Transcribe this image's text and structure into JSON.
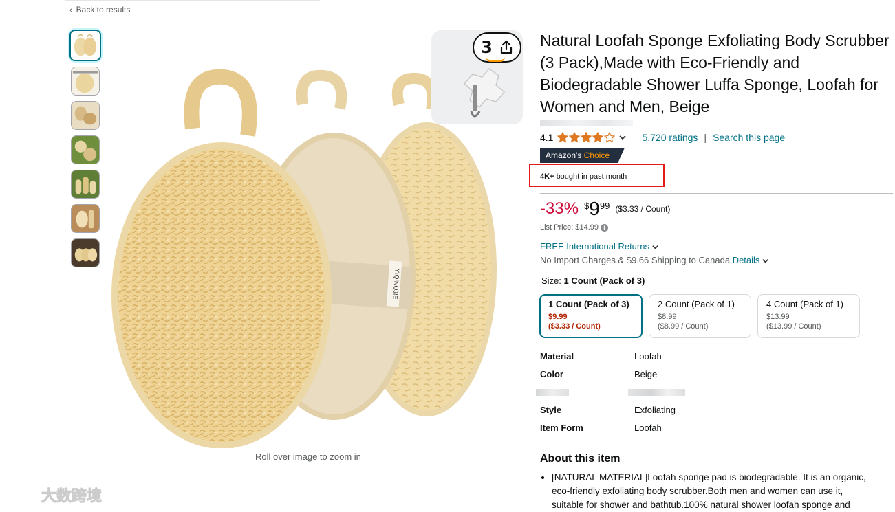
{
  "nav": {
    "back_link": "Back to results"
  },
  "gallery": {
    "zoom_hint": "Roll over image to zoom in",
    "label_text": "YIQINQJIE",
    "thumbnail_count": 7
  },
  "share": {
    "count": "3"
  },
  "product": {
    "title": "Natural Loofah Sponge Exfoliating Body Scrubber (3 Pack),Made with Eco-Friendly and Biodegradable Shower Luffa Sponge, Loofah for Women and Men, Beige",
    "rating": "4.1",
    "rating_stars": 4.1,
    "ratings_count": "5,720 ratings",
    "search_page": "Search this page",
    "separator": "|",
    "badge_prefix": "Amazon's",
    "badge_suffix": "Choice",
    "bought_strong": "4K+",
    "bought_rest": "bought in past month"
  },
  "price": {
    "discount": "-33%",
    "symbol": "$",
    "whole": "9",
    "fraction": "99",
    "unit": "($3.33 / Count)",
    "list_label": "List Price:",
    "list_value": "$14.99",
    "info_icon": "i"
  },
  "delivery": {
    "returns": "FREE International Returns",
    "shipping": "No Import Charges & $9.66 Shipping to Canada",
    "details": "Details"
  },
  "size": {
    "label": "Size:",
    "selected": "1 Count (Pack of 3)",
    "options": [
      {
        "name": "1 Count (Pack of 3)",
        "price": "$9.99",
        "unit": "($3.33 / Count)"
      },
      {
        "name": "2 Count (Pack of 1)",
        "price": "$8.99",
        "unit": "($8.99 / Count)"
      },
      {
        "name": "4 Count (Pack of 1)",
        "price": "$13.99",
        "unit": "($13.99 / Count)"
      }
    ]
  },
  "specs": [
    {
      "key": "Material",
      "value": "Loofah"
    },
    {
      "key": "Color",
      "value": "Beige"
    },
    {
      "key": "Style",
      "value": "Exfoliating"
    },
    {
      "key": "Item Form",
      "value": "Loofah"
    }
  ],
  "about": {
    "heading": "About this item",
    "bullet_1_lines": [
      "[NATURAL MATERIAL]Loofah sponge pad is biodegradable. It is an organic,",
      "eco-friendly exfoliating body scrubber.Both men and women can use it,",
      "suitable for shower and bathtub.100% natural shower loofah sponge and"
    ]
  },
  "watermark": {
    "text": "大数跨境"
  },
  "colors": {
    "link": "#007185",
    "deal_red": "#cc0c39",
    "selected_price": "#b12704",
    "star": "#de7921",
    "badge_bg": "#232f3e",
    "badge_orange": "#ff9900",
    "highlight_box": "#e31a1c"
  }
}
